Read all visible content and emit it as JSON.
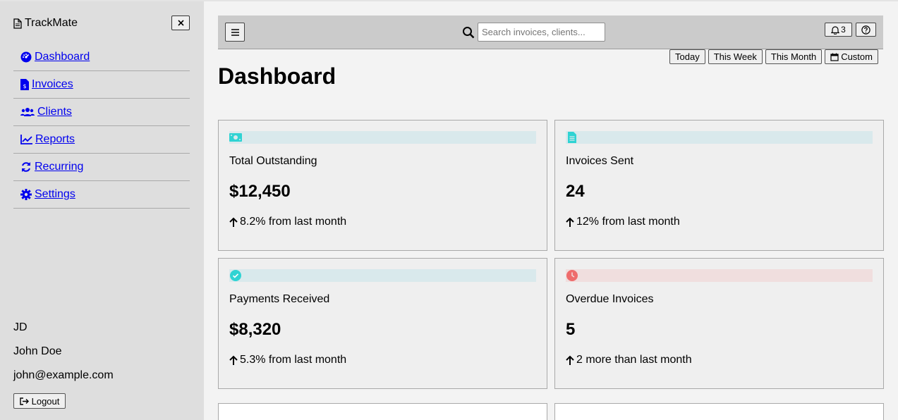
{
  "app": {
    "name": "TrackMate"
  },
  "sidebar": {
    "close_label": "×",
    "items": [
      {
        "label": "Dashboard",
        "icon": "dashboard-icon"
      },
      {
        "label": "Invoices",
        "icon": "invoice-icon"
      },
      {
        "label": "Clients",
        "icon": "users-icon"
      },
      {
        "label": "Reports",
        "icon": "chart-line-icon"
      },
      {
        "label": "Recurring",
        "icon": "sync-icon"
      },
      {
        "label": "Settings",
        "icon": "gear-icon"
      }
    ],
    "user": {
      "initials": "JD",
      "name": "John Doe",
      "email": "john@example.com"
    },
    "logout_label": "Logout"
  },
  "topbar": {
    "search_placeholder": "Search invoices, clients...",
    "notification_count": "3"
  },
  "date_ranges": [
    {
      "label": "Today"
    },
    {
      "label": "This Week"
    },
    {
      "label": "This Month"
    },
    {
      "label": "Custom",
      "icon": "calendar-icon"
    }
  ],
  "page": {
    "title": "Dashboard"
  },
  "cards": [
    {
      "label": "Total Outstanding",
      "value": "$12,450",
      "change": "8.2% from last month",
      "icon": "money-icon",
      "accent": "#2fd3d3",
      "band": "#d9e9ec"
    },
    {
      "label": "Invoices Sent",
      "value": "24",
      "change": "12% from last month",
      "icon": "file-icon",
      "accent": "#2fd3d3",
      "band": "#d9e9ec"
    },
    {
      "label": "Payments Received",
      "value": "$8,320",
      "change": "5.3% from last month",
      "icon": "check-circle-icon",
      "accent": "#2fd3d3",
      "band": "#d9e9ec"
    },
    {
      "label": "Overdue Invoices",
      "value": "5",
      "change": "2 more than last month",
      "icon": "clock-icon",
      "accent": "#ee6c6c",
      "band": "#f0dede"
    }
  ],
  "colors": {
    "link": "#0000ee",
    "sidebar_bg": "#dedede",
    "main_bg": "#f3f3f3",
    "topbar_bg": "#cbcbcb"
  }
}
